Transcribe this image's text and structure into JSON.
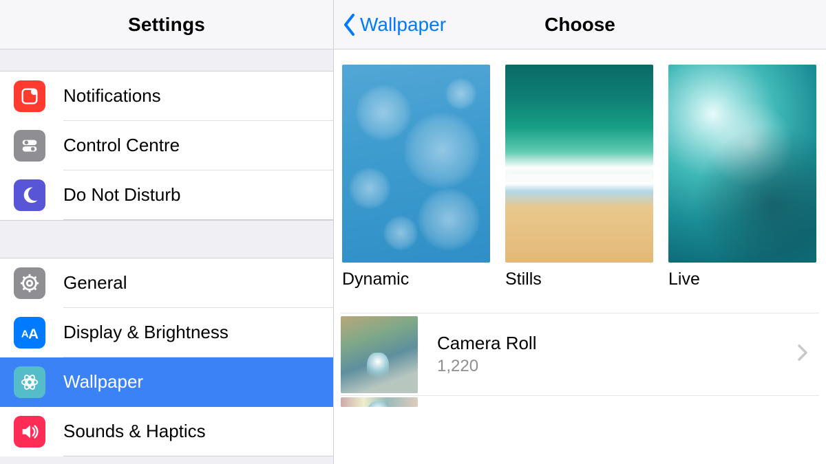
{
  "sidebar": {
    "title": "Settings",
    "groups": [
      {
        "items": [
          {
            "id": "notifications",
            "label": "Notifications",
            "icon": "notifications-icon",
            "selected": false
          },
          {
            "id": "control-centre",
            "label": "Control Centre",
            "icon": "control-centre-icon",
            "selected": false
          },
          {
            "id": "do-not-disturb",
            "label": "Do Not Disturb",
            "icon": "moon-icon",
            "selected": false
          }
        ]
      },
      {
        "items": [
          {
            "id": "general",
            "label": "General",
            "icon": "gear-icon",
            "selected": false
          },
          {
            "id": "display-brightness",
            "label": "Display & Brightness",
            "icon": "display-icon",
            "selected": false
          },
          {
            "id": "wallpaper",
            "label": "Wallpaper",
            "icon": "wallpaper-icon",
            "selected": true
          },
          {
            "id": "sounds-haptics",
            "label": "Sounds & Haptics",
            "icon": "speaker-icon",
            "selected": false
          }
        ]
      }
    ]
  },
  "detail": {
    "back_label": "Wallpaper",
    "title": "Choose",
    "categories": [
      {
        "id": "dynamic",
        "label": "Dynamic"
      },
      {
        "id": "stills",
        "label": "Stills"
      },
      {
        "id": "live",
        "label": "Live"
      }
    ],
    "albums": [
      {
        "id": "camera-roll",
        "name": "Camera Roll",
        "count": "1,220"
      }
    ]
  },
  "colors": {
    "accent": "#007aff",
    "selection": "#3b82f6"
  }
}
